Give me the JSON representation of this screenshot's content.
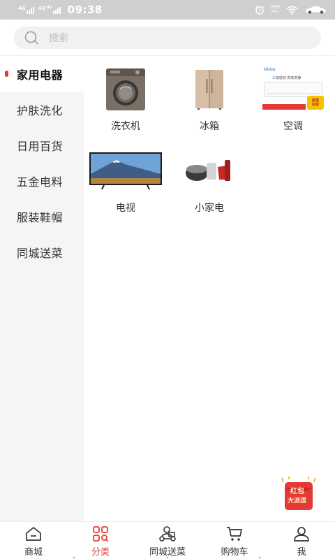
{
  "status_bar": {
    "network1": "4G",
    "network2": "4G",
    "network2_suffix": "HD",
    "time": "09:38",
    "speed_value": "269",
    "speed_unit": "KB/s",
    "icons": [
      "signal-icon",
      "alarm-icon",
      "wifi-icon",
      "car-icon"
    ]
  },
  "search": {
    "placeholder": "搜索",
    "icon": "search-icon"
  },
  "sidebar": {
    "items": [
      {
        "label": "家用电器",
        "active": true
      },
      {
        "label": "护肤洗化",
        "active": false
      },
      {
        "label": "日用百货",
        "active": false
      },
      {
        "label": "五金电料",
        "active": false
      },
      {
        "label": "服装鞋帽",
        "active": false
      },
      {
        "label": "同城送菜",
        "active": false
      }
    ]
  },
  "products": [
    {
      "label": "洗衣机",
      "icon": "washing-machine-image"
    },
    {
      "label": "冰箱",
      "icon": "refrigerator-image"
    },
    {
      "label": "空调",
      "icon": "air-conditioner-image",
      "brand": "Midea",
      "promo": "三级能效 高效安静",
      "badge": "超值好货"
    },
    {
      "label": "电视",
      "icon": "television-image"
    },
    {
      "label": "小家电",
      "icon": "small-appliances-image"
    }
  ],
  "floating": {
    "line1": "红包",
    "line2": "大派送",
    "icon": "red-packet-icon"
  },
  "tabbar": {
    "tabs": [
      {
        "label": "商城",
        "icon": "home-icon",
        "active": false
      },
      {
        "label": "分类",
        "icon": "category-icon",
        "active": true
      },
      {
        "label": "同城送菜",
        "icon": "delivery-icon",
        "active": false
      },
      {
        "label": "购物车",
        "icon": "cart-icon",
        "active": false
      },
      {
        "label": "我",
        "icon": "user-icon",
        "active": false
      }
    ]
  },
  "colors": {
    "accent": "#e53935",
    "sidebar_bg": "#f5f5f5",
    "search_bg": "#f1f1f1",
    "status_bar_bg": "#cfcfcf"
  }
}
